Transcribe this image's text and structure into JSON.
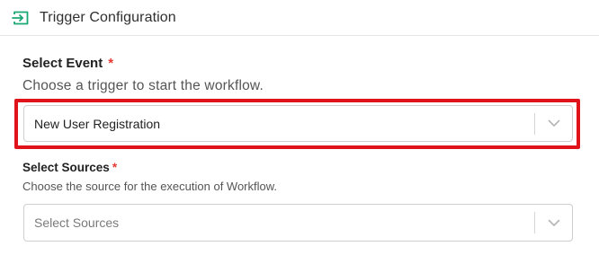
{
  "header": {
    "icon": "enter-arrow-icon",
    "title": "Trigger Configuration",
    "accent_color": "#1aa774"
  },
  "event": {
    "label": "Select Event",
    "required_mark": "*",
    "description": "Choose a trigger to start the workflow.",
    "selected_value": "New User Registration",
    "highlight_color": "#e0131a"
  },
  "sources": {
    "label": "Select Sources",
    "required_mark": "*",
    "description": "Choose the source for the execution of Workflow.",
    "placeholder": "Select Sources"
  }
}
